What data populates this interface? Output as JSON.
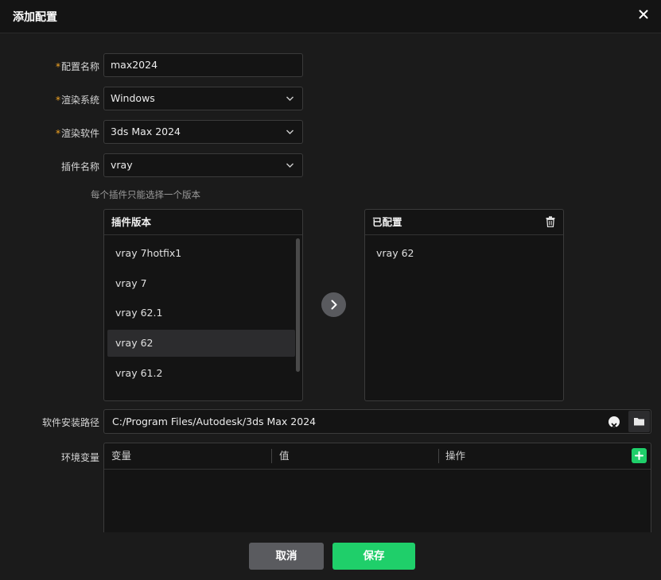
{
  "dialog": {
    "title": "添加配置",
    "close_icon": "close-icon"
  },
  "form": {
    "config_name": {
      "required": "*",
      "label": "配置名称",
      "value": "max2024"
    },
    "render_system": {
      "required": "*",
      "label": "渲染系统",
      "value": "Windows"
    },
    "render_software": {
      "required": "*",
      "label": "渲染软件",
      "value": "3ds Max 2024"
    },
    "plugin_name": {
      "label": "插件名称",
      "value": "vray"
    },
    "hint": "每个插件只能选择一个版本"
  },
  "plugin_versions": {
    "header": "插件版本",
    "items": [
      "vray 7hotfix1",
      "vray 7",
      "vray 62.1",
      "vray 62",
      "vray 61.2"
    ],
    "selected": "vray 62"
  },
  "configured": {
    "header": "已配置",
    "items": [
      "vray 62"
    ],
    "delete_icon": "trash-icon"
  },
  "install_path": {
    "label": "软件安装路径",
    "value": "C:/Program Files/Autodesk/3ds Max 2024"
  },
  "env_vars": {
    "label": "环境变量",
    "columns": [
      "变量",
      "值",
      "操作"
    ]
  },
  "footer": {
    "cancel_label": "取消",
    "save_label": "保存"
  },
  "colors": {
    "accent": "#1fcf6a",
    "required": "#f5a623",
    "background": "#1b1b1b"
  }
}
